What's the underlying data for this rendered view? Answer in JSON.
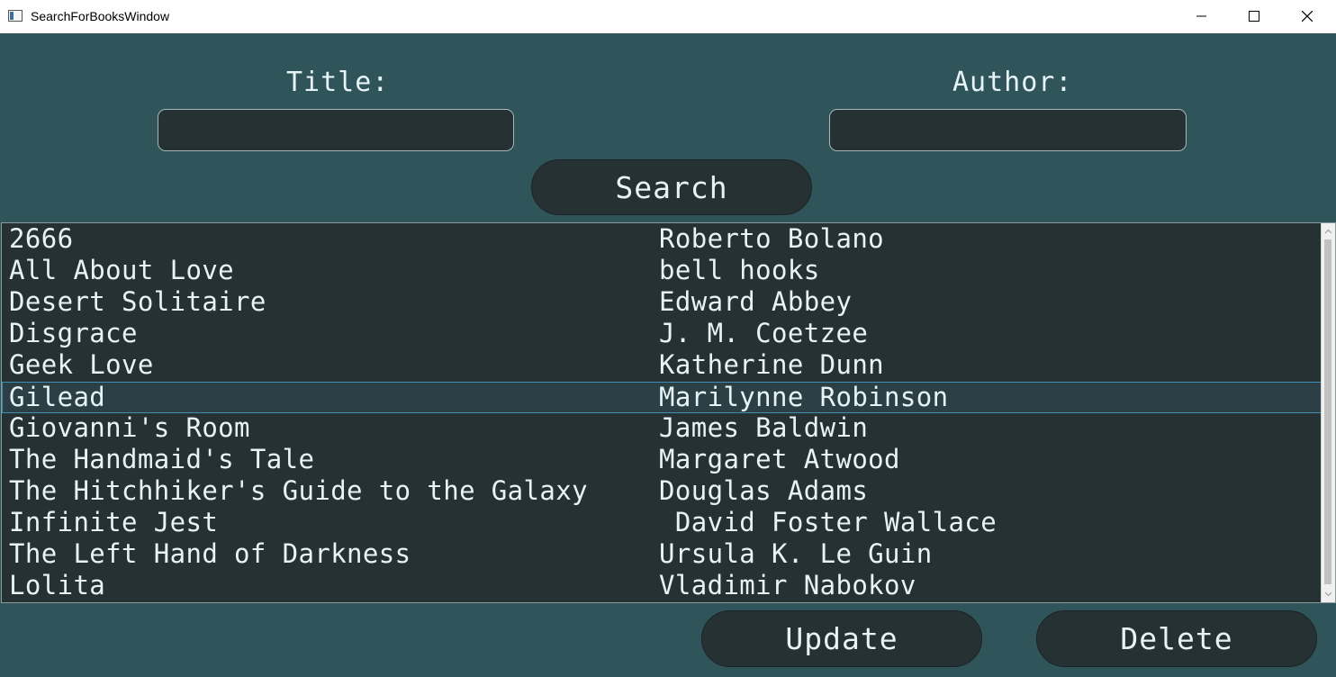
{
  "window": {
    "title": "SearchForBooksWindow"
  },
  "form": {
    "title_label": "Title:",
    "author_label": "Author:",
    "title_value": "",
    "author_value": "",
    "search_label": "Search"
  },
  "books": [
    {
      "title": "2666",
      "author": "Roberto Bolano"
    },
    {
      "title": "All About Love",
      "author": "bell hooks"
    },
    {
      "title": "Desert Solitaire",
      "author": "Edward Abbey"
    },
    {
      "title": "Disgrace",
      "author": "J. M. Coetzee"
    },
    {
      "title": "Geek Love",
      "author": "Katherine Dunn"
    },
    {
      "title": "Gilead",
      "author": "Marilynne Robinson"
    },
    {
      "title": "Giovanni's Room",
      "author": "James Baldwin"
    },
    {
      "title": "The Handmaid's Tale",
      "author": "Margaret Atwood"
    },
    {
      "title": "The Hitchhiker's Guide to the Galaxy",
      "author": "Douglas Adams"
    },
    {
      "title": "Infinite Jest",
      "author": " David Foster Wallace"
    },
    {
      "title": "The Left Hand of Darkness",
      "author": "Ursula K. Le Guin"
    },
    {
      "title": "Lolita",
      "author": "Vladimir Nabokov"
    }
  ],
  "selected_index": 5,
  "actions": {
    "update_label": "Update",
    "delete_label": "Delete"
  },
  "icons": {
    "app": "app-window-icon",
    "minimize": "minimize-icon",
    "maximize": "maximize-icon",
    "close": "close-icon"
  },
  "colors": {
    "background": "#2f5459",
    "control": "#263134",
    "text": "#e6f4f8",
    "selection_border": "#3f8fb3"
  }
}
